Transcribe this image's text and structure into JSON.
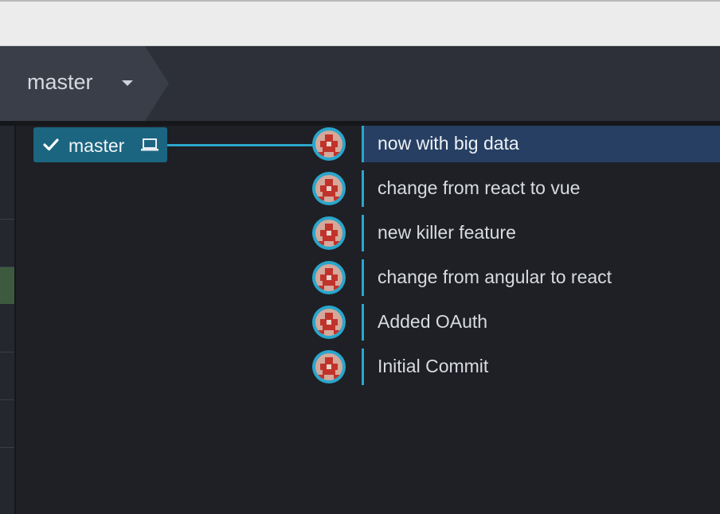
{
  "toolbar": {
    "branch_label": "master"
  },
  "graph": {
    "branch_tag": {
      "name": "master"
    },
    "commits": [
      {
        "message": "now with big data",
        "selected": true
      },
      {
        "message": "change from react to vue",
        "selected": false
      },
      {
        "message": "new killer feature",
        "selected": false
      },
      {
        "message": "change from angular to react",
        "selected": false
      },
      {
        "message": "Added OAuth",
        "selected": false
      },
      {
        "message": "Initial Commit",
        "selected": false
      }
    ]
  },
  "colors": {
    "accent": "#2aa6cc",
    "branch_tag_bg": "#1b6580",
    "selected_row": "#263f63",
    "avatar_red": "#c0332b"
  },
  "icons": {
    "branch_dropdown": "chevron-down-icon",
    "branch_checked": "check-icon",
    "local_branch": "laptop-icon",
    "commit_avatar": "identicon-avatar-icon"
  }
}
